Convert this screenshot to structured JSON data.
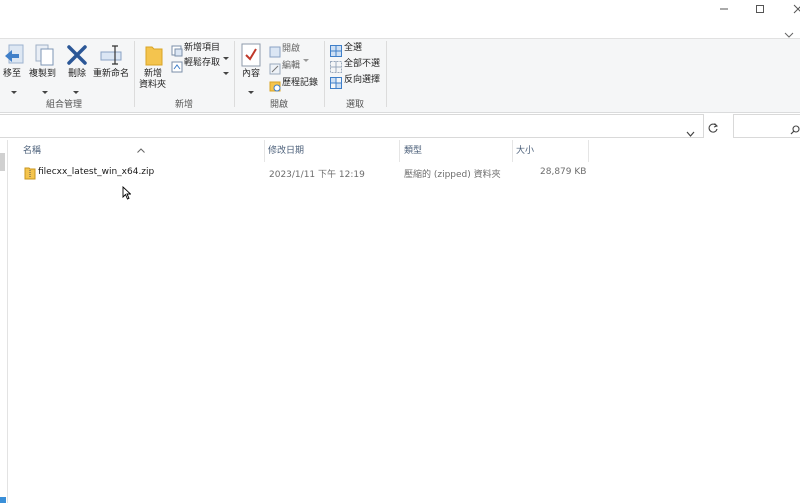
{
  "window": {
    "minimize_icon": "minimize-icon",
    "maximize_icon": "maximize-icon",
    "close_icon": "close-icon",
    "ribbon_expand_icon": "chevron-down-icon"
  },
  "ribbon": {
    "organize": {
      "move_label": "移至",
      "copy_label": "複製到",
      "delete_label": "刪除",
      "rename_label": "重新命名",
      "group_label": "組合管理"
    },
    "new": {
      "new_folder_label_1": "新增",
      "new_folder_label_2": "資料夾",
      "new_item_label": "新增項目",
      "easy_access_label": "輕鬆存取",
      "group_label": "新增"
    },
    "open": {
      "properties_label": "內容",
      "open_label": "開啟",
      "edit_label": "編輯",
      "history_label": "歷程記錄",
      "group_label": "開啟"
    },
    "select": {
      "select_all_label": "全選",
      "select_none_label": "全部不選",
      "invert_label": "反向選擇",
      "group_label": "選取"
    }
  },
  "address_bar": {
    "dropdown_icon": "chevron-down-icon",
    "refresh_icon": "refresh-icon",
    "search_icon": "search-icon"
  },
  "columns": {
    "name": "名稱",
    "modified": "修改日期",
    "type": "類型",
    "size": "大小"
  },
  "files": [
    {
      "name": "filecxx_latest_win_x64.zip",
      "modified": "2023/1/11 下午 12:19",
      "type": "壓縮的 (zipped) 資料夾",
      "size": "28,879 KB",
      "icon": "zip-folder-icon"
    }
  ]
}
